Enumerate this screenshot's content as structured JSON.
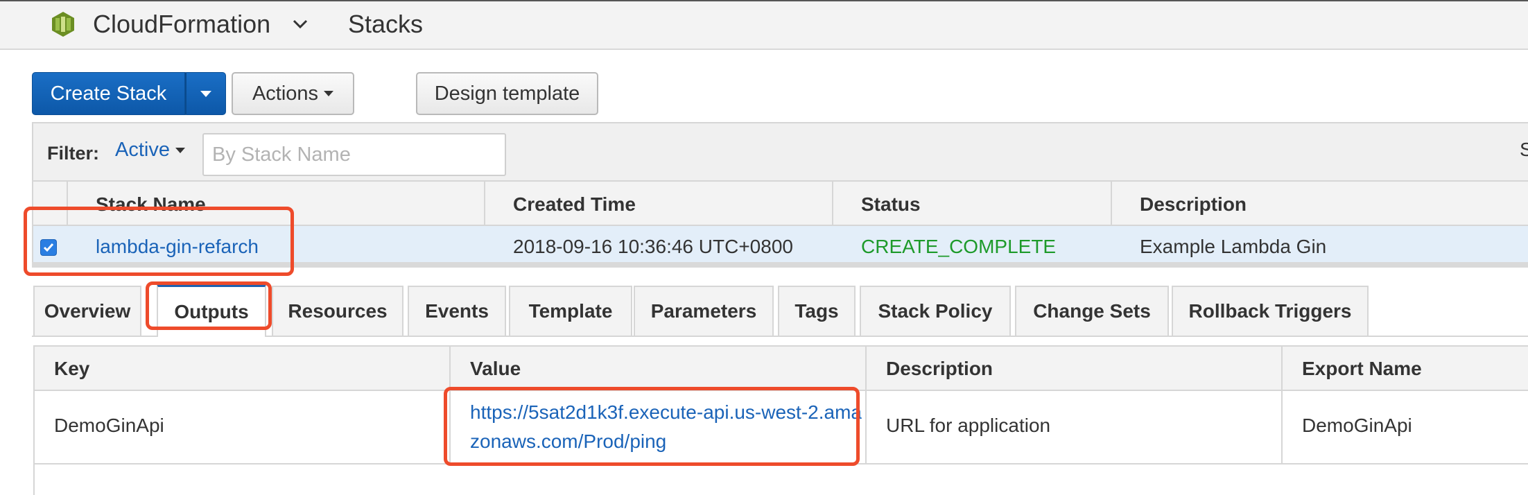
{
  "header": {
    "service_name": "CloudFormation",
    "page_name": "Stacks",
    "logo_icon": "cloudformation-logo-icon",
    "accent": "#1f62b0"
  },
  "toolbar": {
    "create_stack_label": "Create Stack",
    "actions_label": "Actions",
    "design_template_label": "Design template"
  },
  "filter": {
    "label": "Filter:",
    "active_label": "Active",
    "search_placeholder": "By Stack Name",
    "truncated_text": "S"
  },
  "stacks_table": {
    "columns": [
      "Stack Name",
      "Created Time",
      "Status",
      "Description"
    ],
    "rows": [
      {
        "selected": true,
        "stack_name": "lambda-gin-refarch",
        "created_time": "2018-09-16 10:36:46 UTC+0800",
        "status": "CREATE_COMPLETE",
        "description": "Example Lambda Gin"
      }
    ]
  },
  "tabs": [
    {
      "label": "Overview",
      "active": false
    },
    {
      "label": "Outputs",
      "active": true
    },
    {
      "label": "Resources",
      "active": false
    },
    {
      "label": "Events",
      "active": false
    },
    {
      "label": "Template",
      "active": false
    },
    {
      "label": "Parameters",
      "active": false
    },
    {
      "label": "Tags",
      "active": false
    },
    {
      "label": "Stack Policy",
      "active": false
    },
    {
      "label": "Change Sets",
      "active": false
    },
    {
      "label": "Rollback Triggers",
      "active": false
    }
  ],
  "outputs_table": {
    "columns": [
      "Key",
      "Value",
      "Description",
      "Export Name"
    ],
    "rows": [
      {
        "key": "DemoGinApi",
        "value": "https://5sat2d1k3f.execute-api.us-west-2.amazonaws.com/Prod/ping",
        "description": "URL for application",
        "export_name": "DemoGinApi"
      }
    ]
  },
  "colors": {
    "status_ok": "#1d9a2a",
    "link": "#1a63b8",
    "primary_button": "#0d58a8",
    "annotation": "#ee4b2b",
    "selected_row": "#e3eef9"
  }
}
